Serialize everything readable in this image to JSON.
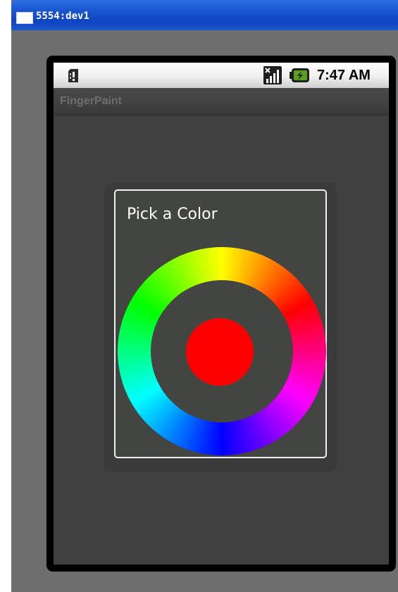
{
  "window": {
    "title": "5554:dev1"
  },
  "statusbar": {
    "time": "7:47 AM",
    "icons": [
      "sim-alert-icon",
      "signal-no-data-icon",
      "battery-charging-icon"
    ]
  },
  "app": {
    "title": "FingerPaint"
  },
  "dialog": {
    "title": "Pick a Color",
    "selected_color": "#ff0000",
    "wheel_colors": [
      "#ffff00",
      "#ff0000",
      "#ff00ff",
      "#0000ff",
      "#00ffff",
      "#00ff00"
    ]
  },
  "colors": {
    "titlebar": "#1a55d0",
    "emulator_bg": "#6e6e6e",
    "screen_bg": "#404040",
    "dialog_bg": "#434541",
    "dialog_border": "#f0f0f0"
  }
}
